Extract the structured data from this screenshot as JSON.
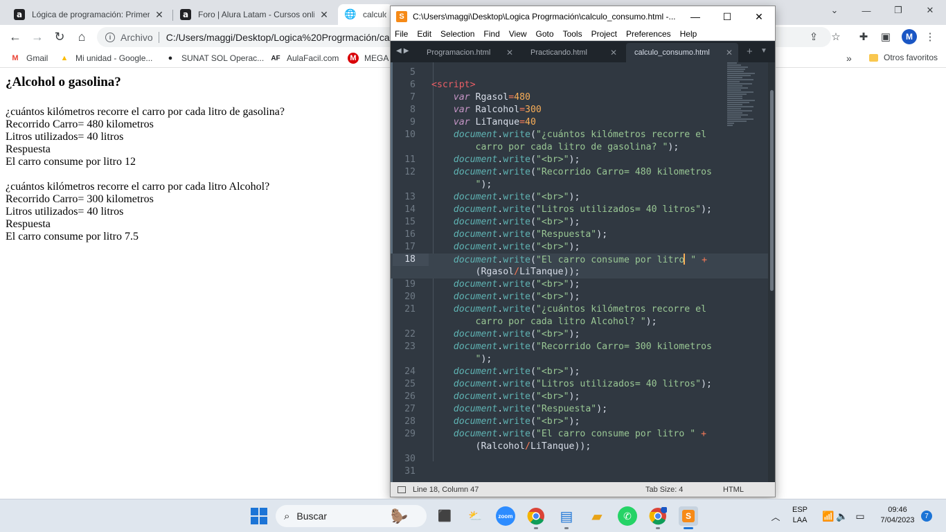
{
  "browser": {
    "tabs": [
      {
        "title": "Lógica de programación: Primerc",
        "icon": "a"
      },
      {
        "title": "Foro | Alura Latam - Cursos onlin",
        "icon": "a"
      },
      {
        "title": "calculo_",
        "icon": "globe"
      }
    ],
    "address": {
      "secure_label": "Archivo",
      "url": "C:/Users/maggi/Desktop/Logica%20Progrmación/ca"
    },
    "avatar_letter": "M",
    "bookmarks": [
      {
        "label": "Gmail",
        "icon": "M",
        "color": "#ea4335"
      },
      {
        "label": "Mi unidad - Google...",
        "icon": "▲",
        "color": "#fbbc04"
      },
      {
        "label": "SUNAT SOL Operac...",
        "icon": "●",
        "color": "#202124"
      },
      {
        "label": "AulaFacil.com",
        "icon": "AF",
        "color": "#202124"
      },
      {
        "label": "MEGA",
        "icon": "M",
        "color": "#d90007"
      }
    ],
    "other_bookmarks": "Otros favoritos",
    "more_bookmarks": "»"
  },
  "page": {
    "heading": "¿Alcohol o gasolina?",
    "block1": [
      "¿cuántos kilómetros recorre el carro por cada litro de gasolina?",
      "Recorrido Carro= 480 kilometros",
      "Litros utilizados= 40 litros",
      "Respuesta",
      "El carro consume por litro 12"
    ],
    "block2": [
      "¿cuántos kilómetros recorre el carro por cada litro Alcohol?",
      "Recorrido Carro= 300 kilometros",
      "Litros utilizados= 40 litros",
      "Respuesta",
      "El carro consume por litro 7.5"
    ]
  },
  "editor": {
    "title": "C:\\Users\\maggi\\Desktop\\Logica Progrmación\\calculo_consumo.html -...",
    "menu": [
      "File",
      "Edit",
      "Selection",
      "Find",
      "View",
      "Goto",
      "Tools",
      "Project",
      "Preferences",
      "Help"
    ],
    "tabs": [
      {
        "name": "Programacion.html",
        "active": false
      },
      {
        "name": "Practicando.html",
        "active": false
      },
      {
        "name": "calculo_consumo.html",
        "active": true
      }
    ],
    "line_numbers": [
      "5",
      "6",
      "7",
      "8",
      "9",
      "10",
      "",
      "11",
      "12",
      "",
      "13",
      "14",
      "15",
      "16",
      "17",
      "18",
      "",
      "19",
      "20",
      "21",
      "",
      "22",
      "23",
      "",
      "24",
      "25",
      "26",
      "27",
      "28",
      "29",
      "",
      "30",
      "31"
    ],
    "status": {
      "position": "Line 18, Column 47",
      "tab_size": "Tab Size: 4",
      "syntax": "HTML"
    },
    "strings": {
      "tag_open": "<script>",
      "v1": "Rgasol",
      "v1val": "480",
      "v2": "Ralcohol",
      "v2val": "300",
      "v3": "LiTanque",
      "v3val": "40",
      "q1a": "\"¿cuántos kilómetros recorre el",
      "q1b": "carro por cada litro de gasolina? \"",
      "br": "\"<br>\"",
      "r1a": "\"Recorrido Carro= 480 kilometros",
      "r1b": "\"",
      "lit": "\"Litros utilizados= 40 litros\"",
      "resp": "\"Respuesta\"",
      "cons_a": "\"El carro consume por litro",
      "cons_b": " \"",
      "cons_full": "\"El carro consume por litro \"",
      "q2a": "\"¿cuántos kilómetros recorre el",
      "q2b": "carro por cada litro Alcohol? \"",
      "r2a": "\"Recorrido Carro= 300 kilometros",
      "r2b": "\""
    }
  },
  "taskbar": {
    "search_label": "Buscar",
    "lang_top": "ESP",
    "lang_bottom": "LAA",
    "time": "09:46",
    "date": "7/04/2023",
    "notifications": "7"
  }
}
